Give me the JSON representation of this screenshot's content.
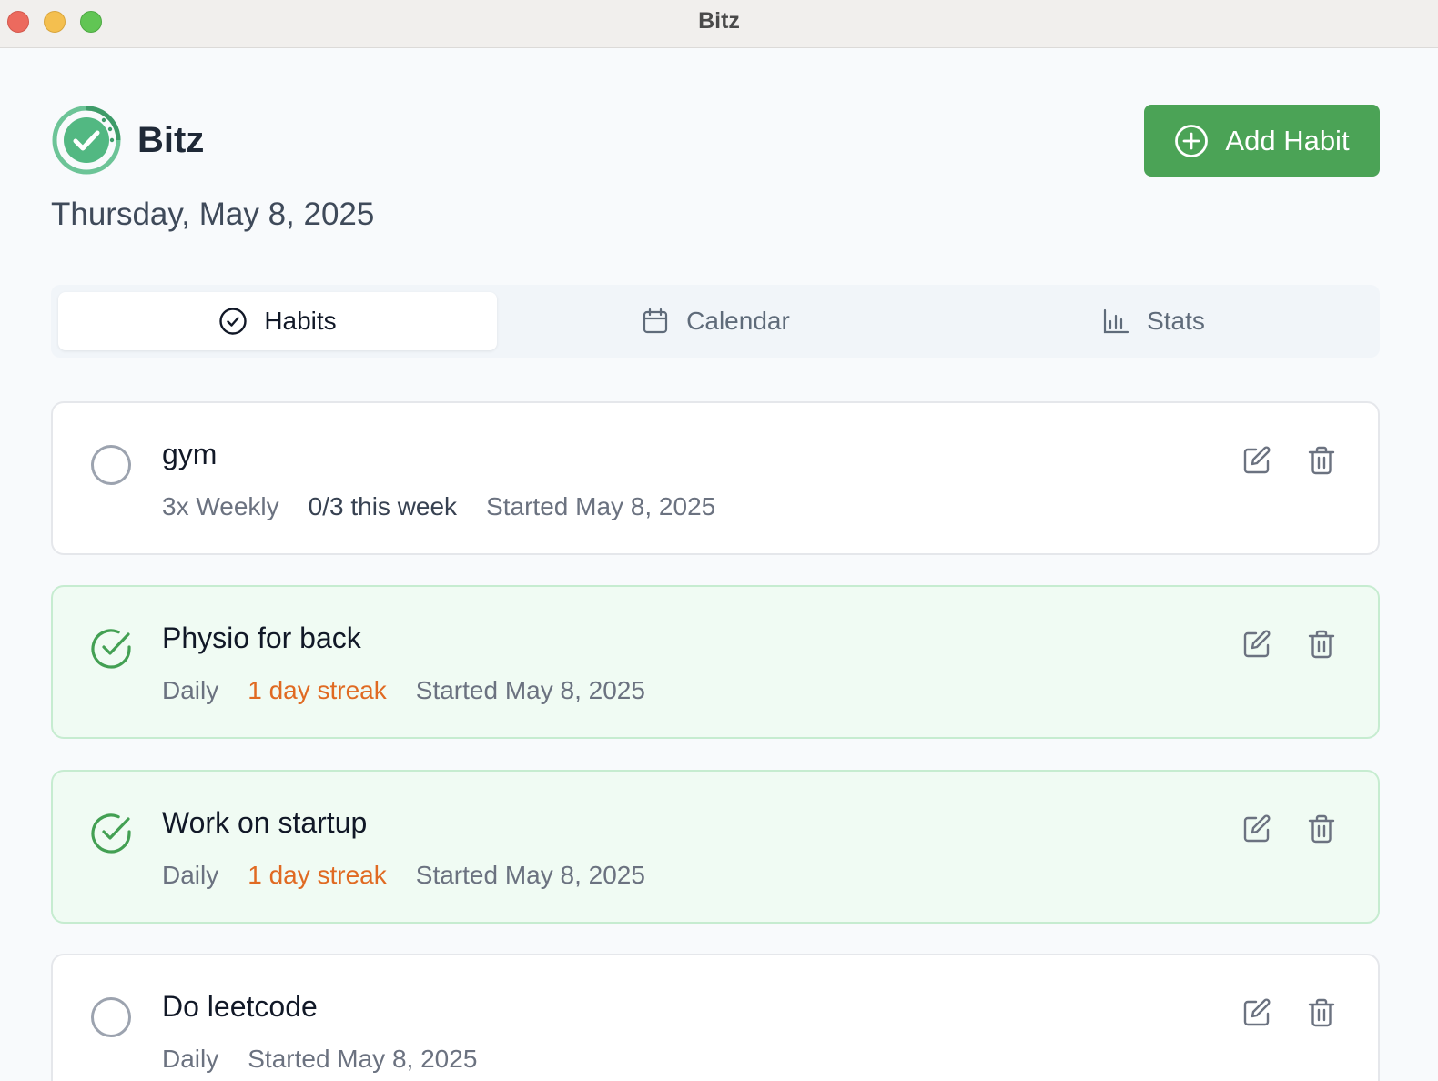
{
  "window": {
    "title": "Bitz"
  },
  "header": {
    "app_name": "Bitz",
    "date": "Thursday, May 8, 2025",
    "add_button_label": "Add Habit",
    "brand_color": "#4ba356"
  },
  "tabs": [
    {
      "label": "Habits",
      "icon": "check-circle-icon",
      "active": true
    },
    {
      "label": "Calendar",
      "icon": "calendar-icon",
      "active": false
    },
    {
      "label": "Stats",
      "icon": "bar-chart-icon",
      "active": false
    }
  ],
  "habits": [
    {
      "name": "gym",
      "completed": false,
      "frequency": "3x Weekly",
      "progress": "0/3 this week",
      "started": "Started May 8, 2025"
    },
    {
      "name": "Physio for back",
      "completed": true,
      "frequency": "Daily",
      "streak": "1 day streak",
      "started": "Started May 8, 2025"
    },
    {
      "name": "Work on startup",
      "completed": true,
      "frequency": "Daily",
      "streak": "1 day streak",
      "started": "Started May 8, 2025"
    },
    {
      "name": "Do leetcode",
      "completed": false,
      "frequency": "Daily",
      "started": "Started May 8, 2025"
    }
  ]
}
